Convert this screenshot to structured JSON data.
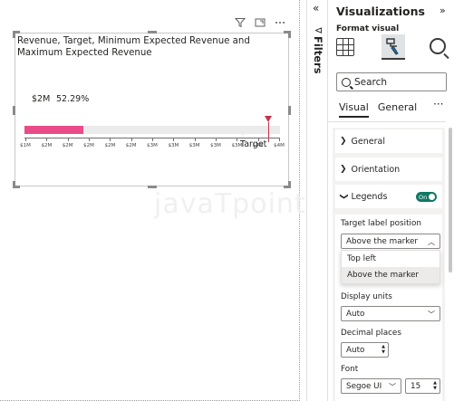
{
  "visual": {
    "title": "Revenue, Target, Minimum Expected Revenue and Maximum Expected Revenue",
    "value_label": "$2M",
    "percent_label": "52.29%",
    "target_value": "$3.71M",
    "target_label": "Target",
    "header_icons": [
      "filter-icon",
      "focus-mode-icon",
      "more-options-icon"
    ],
    "fill_color": "#ea4c89",
    "target_color": "#c4314b",
    "fill_fraction": 0.2299,
    "target_fraction": 0.955,
    "ticks": [
      "$1M",
      "$2M",
      "$2M",
      "$2M",
      "$2M",
      "$2M",
      "$3M",
      "$3M",
      "$3M",
      "$3M",
      "$3M",
      "$4M",
      "$4M"
    ]
  },
  "watermark": "javaTpoint",
  "filters": {
    "label": "Filters",
    "collapse_glyph": "«",
    "funnel_glyph": "⊲"
  },
  "viz_pane": {
    "title": "Visualizations",
    "collapse_glyph": "»",
    "format_visual_label": "Format visual",
    "search_placeholder": "Search",
    "tabs": [
      {
        "label": "Visual",
        "active": true
      },
      {
        "label": "General",
        "active": false
      }
    ],
    "more_glyph": "···",
    "sections": [
      {
        "label": "General",
        "expanded": false
      },
      {
        "label": "Orientation",
        "expanded": false
      },
      {
        "label": "Legends",
        "expanded": true
      }
    ],
    "legends_toggle": "On",
    "accent_color": "#117865",
    "target_label_position": {
      "label": "Target label position",
      "value": "Above the marker",
      "options": [
        {
          "label": "Top left",
          "selected": false
        },
        {
          "label": "Above the marker",
          "selected": true
        }
      ]
    },
    "display_units": {
      "label": "Display units",
      "value": "Auto"
    },
    "decimal_places": {
      "label": "Decimal places",
      "value": "Auto"
    },
    "font": {
      "label": "Font",
      "family": "Segoe UI",
      "size": "15"
    }
  }
}
